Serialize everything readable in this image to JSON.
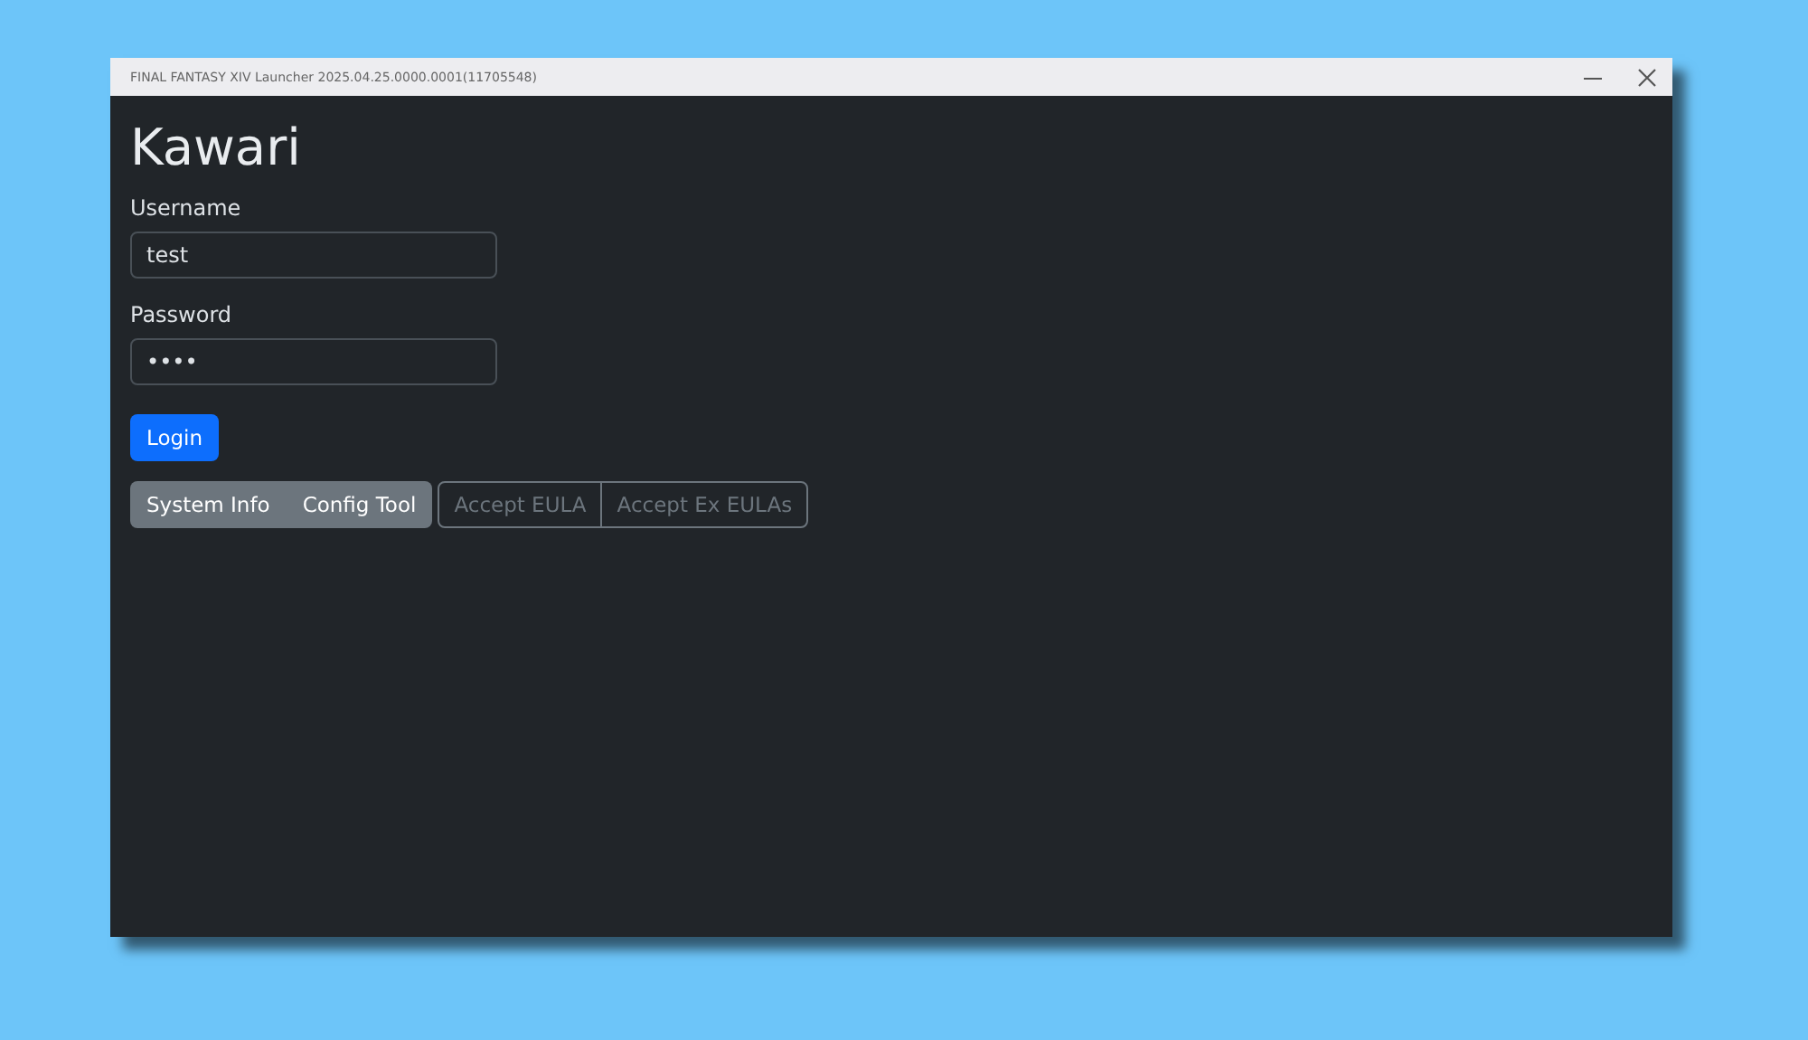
{
  "window": {
    "title": "FINAL FANTASY XIV Launcher 2025.04.25.0000.0001(11705548)"
  },
  "heading": "Kawari",
  "fields": [
    {
      "label": "Username",
      "value": "test"
    },
    {
      "label": "Password",
      "value": "••••"
    }
  ],
  "login_button": "Login",
  "button_groups": [
    [
      {
        "label": "System Info",
        "kind": "secondary"
      },
      {
        "label": "Config Tool",
        "kind": "secondary"
      }
    ],
    [
      {
        "label": "Accept EULA",
        "kind": "outline"
      },
      {
        "label": "Accept Ex EULAs",
        "kind": "outline"
      }
    ]
  ]
}
